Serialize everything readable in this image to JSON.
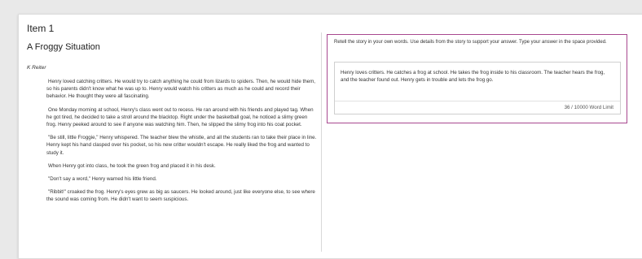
{
  "item": {
    "title": "Item 1"
  },
  "story": {
    "title": "A Froggy Situation",
    "author": "K Reiter",
    "paragraphs": [
      "Henry loved catching critters. He would try to catch anything he could from lizards to spiders. Then, he would hide them, so his parents didn't know what he was up to. Henry would watch his critters as much as he could and record their behavior. He thought they were all fascinating.",
      "One Monday morning at school, Henry's class went out to recess. He ran around with his friends and played tag. When he got tired, he decided to take a stroll around the blacktop. Right under the basketball goal, he noticed a slimy green frog. Henry peeked around to see if anyone was watching him. Then, he slipped the slimy frog into his coat pocket.",
      "\"Be still, little Froggie,\" Henry whispered. The teacher blew the whistle, and all the students ran to take their place in line. Henry kept his hand clasped over his pocket, so his new critter wouldn't escape. He really liked the frog and wanted to study it.",
      "When Henry got into class, he took the green frog and placed it in his desk.",
      "\"Don't say a word,\" Henry warned his little friend.",
      "\"Ribbit!\" croaked the frog. Henry's eyes grew as big as saucers. He looked around, just like everyone else, to see where the sound was coming from. He didn't want to seem suspicious."
    ]
  },
  "question": {
    "prompt": "Retell the story in your own words. Use details from the story to support your answer. Type your answer in the space provided.",
    "answer": "Henry loves critters. He catches a frog at school. He takes the frog inside to his classroom. The teacher hears the frog, and the teacher found out. Henry gets in trouble and lets the frog go.",
    "word_limit": "36 / 10000 Word Limit",
    "accent_color": "#a8488f"
  }
}
